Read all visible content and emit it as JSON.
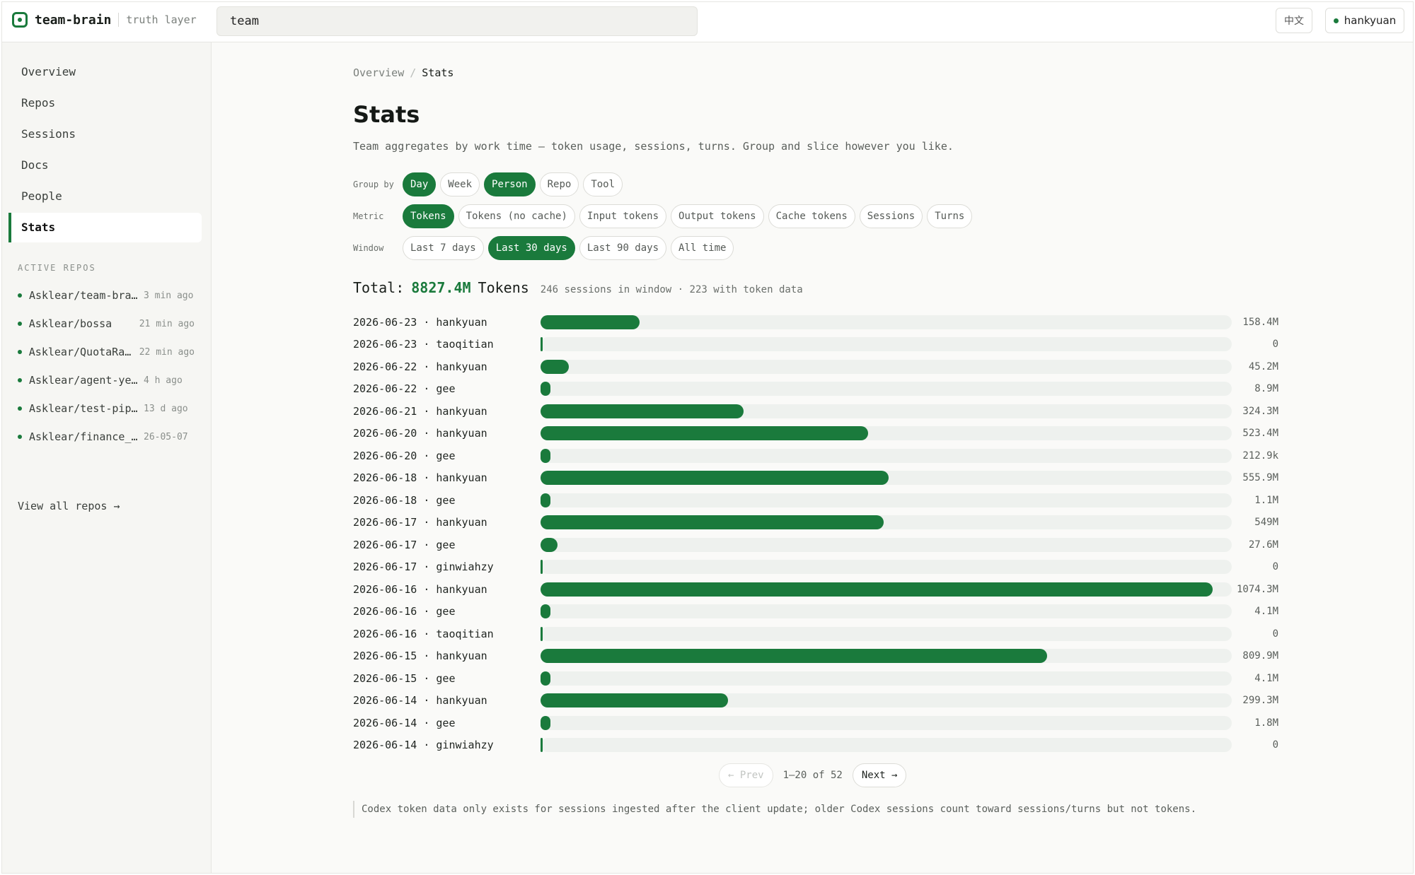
{
  "header": {
    "brand_name": "team-brain",
    "brand_tag": "truth layer",
    "search_value": "team",
    "lang_label": "中文",
    "user_label": "hankyuan"
  },
  "sidebar": {
    "nav": [
      {
        "label": "Overview"
      },
      {
        "label": "Repos"
      },
      {
        "label": "Sessions"
      },
      {
        "label": "Docs"
      },
      {
        "label": "People"
      },
      {
        "label": "Stats",
        "active": true
      }
    ],
    "section_label": "ACTIVE REPOS",
    "repos": [
      {
        "name": "Asklear/team-brain",
        "time": "3 min ago"
      },
      {
        "name": "Asklear/bossa",
        "time": "21 min ago"
      },
      {
        "name": "Asklear/QuotaRadar",
        "time": "22 min ago"
      },
      {
        "name": "Asklear/agent-yedo",
        "time": "4 h ago"
      },
      {
        "name": "Asklear/test-pipeline",
        "time": "13 d ago"
      },
      {
        "name": "Asklear/finance_tools",
        "time": "26-05-07"
      }
    ],
    "view_all": "View all repos →"
  },
  "main": {
    "crumb_home": "Overview",
    "crumb_sep": "/",
    "crumb_current": "Stats",
    "title": "Stats",
    "description": "Team aggregates by work time — token usage, sessions, turns. Group and slice however you like.",
    "group_by": {
      "label": "Group by",
      "options": [
        {
          "label": "Day",
          "on": true
        },
        {
          "label": "Week",
          "on": false
        },
        {
          "label": "Person",
          "on": true
        },
        {
          "label": "Repo",
          "on": false
        },
        {
          "label": "Tool",
          "on": false
        }
      ]
    },
    "metric": {
      "label": "Metric",
      "options": [
        {
          "label": "Tokens",
          "on": true
        },
        {
          "label": "Tokens (no cache)",
          "on": false
        },
        {
          "label": "Input tokens",
          "on": false
        },
        {
          "label": "Output tokens",
          "on": false
        },
        {
          "label": "Cache tokens",
          "on": false
        },
        {
          "label": "Sessions",
          "on": false
        },
        {
          "label": "Turns",
          "on": false
        }
      ]
    },
    "window": {
      "label": "Window",
      "options": [
        {
          "label": "Last 7 days",
          "on": false
        },
        {
          "label": "Last 30 days",
          "on": true
        },
        {
          "label": "Last 90 days",
          "on": false
        },
        {
          "label": "All time",
          "on": false
        }
      ]
    },
    "total_label": "Total:",
    "total_value": "8827.4M",
    "total_unit": "Tokens",
    "total_meta": "246 sessions in window · 223 with token data",
    "pager": {
      "prev": "← Prev",
      "info": "1–20 of 52",
      "next": "Next →"
    },
    "note": "Codex token data only exists for sessions ingested after the client update; older Codex sessions count toward sessions/turns but not tokens."
  },
  "chart_data": {
    "type": "bar",
    "orientation": "horizontal",
    "metric": "Tokens (M)",
    "max_value": 1074.3,
    "categories": [
      "2026-06-23 · hankyuan",
      "2026-06-23 · taoqitian",
      "2026-06-22 · hankyuan",
      "2026-06-22 · gee",
      "2026-06-21 · hankyuan",
      "2026-06-20 · hankyuan",
      "2026-06-20 · gee",
      "2026-06-18 · hankyuan",
      "2026-06-18 · gee",
      "2026-06-17 · hankyuan",
      "2026-06-17 · gee",
      "2026-06-17 · ginwiahzy",
      "2026-06-16 · hankyuan",
      "2026-06-16 · gee",
      "2026-06-16 · taoqitian",
      "2026-06-15 · hankyuan",
      "2026-06-15 · gee",
      "2026-06-14 · hankyuan",
      "2026-06-14 · gee",
      "2026-06-14 · ginwiahzy"
    ],
    "values": [
      158.4,
      0,
      45.2,
      8.9,
      324.3,
      523.4,
      0.2129,
      555.9,
      1.1,
      549,
      27.6,
      0,
      1074.3,
      4.1,
      0,
      809.9,
      4.1,
      299.3,
      1.8,
      0
    ],
    "value_labels": [
      "158.4M",
      "0",
      "45.2M",
      "8.9M",
      "324.3M",
      "523.4M",
      "212.9k",
      "555.9M",
      "1.1M",
      "549M",
      "27.6M",
      "0",
      "1074.3M",
      "4.1M",
      "0",
      "809.9M",
      "4.1M",
      "299.3M",
      "1.8M",
      "0"
    ]
  }
}
